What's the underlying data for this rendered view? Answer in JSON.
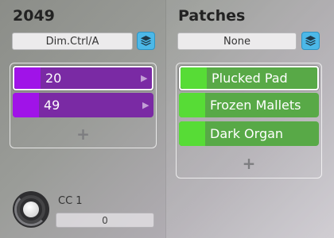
{
  "left": {
    "title": "2049",
    "dropdown_value": "Dim.Ctrl/A",
    "rows": [
      {
        "label": "20",
        "selected": true
      },
      {
        "label": "49",
        "selected": false
      }
    ],
    "add_symbol": "+"
  },
  "right": {
    "title": "Patches",
    "dropdown_value": "None",
    "rows": [
      {
        "label": "Plucked Pad",
        "selected": true
      },
      {
        "label": "Frozen Mallets",
        "selected": false
      },
      {
        "label": "Dark Organ",
        "selected": false
      }
    ],
    "add_symbol": "+"
  },
  "controller": {
    "label": "CC 1",
    "value": "0"
  },
  "colors": {
    "layers_button": "#4cb8e8",
    "purple_row": "#7a2aa4",
    "purple_swatch": "#a013e8",
    "green_row": "#58a947",
    "green_swatch": "#57dc36"
  },
  "icons": {
    "layers": "layers-icon",
    "chevron": "chevron-right-icon",
    "add": "plus-icon"
  }
}
